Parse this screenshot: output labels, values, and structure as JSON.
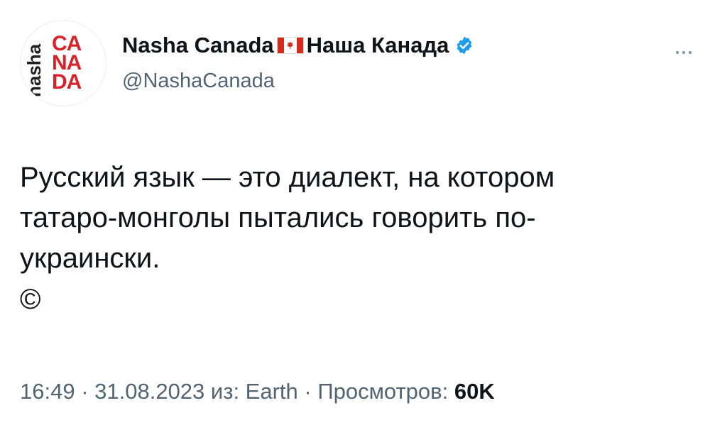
{
  "author": {
    "avatar": {
      "side_text": "nasha",
      "stack_lines": [
        "CA",
        "NA",
        "DA"
      ]
    },
    "display_name": "Nasha Canada",
    "flag_icon": "canada-flag-icon",
    "display_name_ru": "Наша Канада",
    "verified_icon": "verified-badge-icon",
    "handle": "@NashaCanada"
  },
  "more_icon": "more-icon",
  "tweet": {
    "text_line1": "Русский язык — это диалект, на котором",
    "text_line2": "татаро-монголы пытались говорить по-",
    "text_line3": "украински.",
    "copyright": "©"
  },
  "meta": {
    "time": "16:49",
    "sep1": " · ",
    "date": "31.08.2023",
    "source_prefix": " из: ",
    "source": "Earth",
    "sep2": " · ",
    "views_label": "Просмотров: ",
    "views_count": "60K"
  },
  "colors": {
    "brand_red": "#d8232a",
    "verified_blue": "#1d9bf0",
    "text_primary": "#0f1419",
    "text_secondary": "#536471"
  }
}
